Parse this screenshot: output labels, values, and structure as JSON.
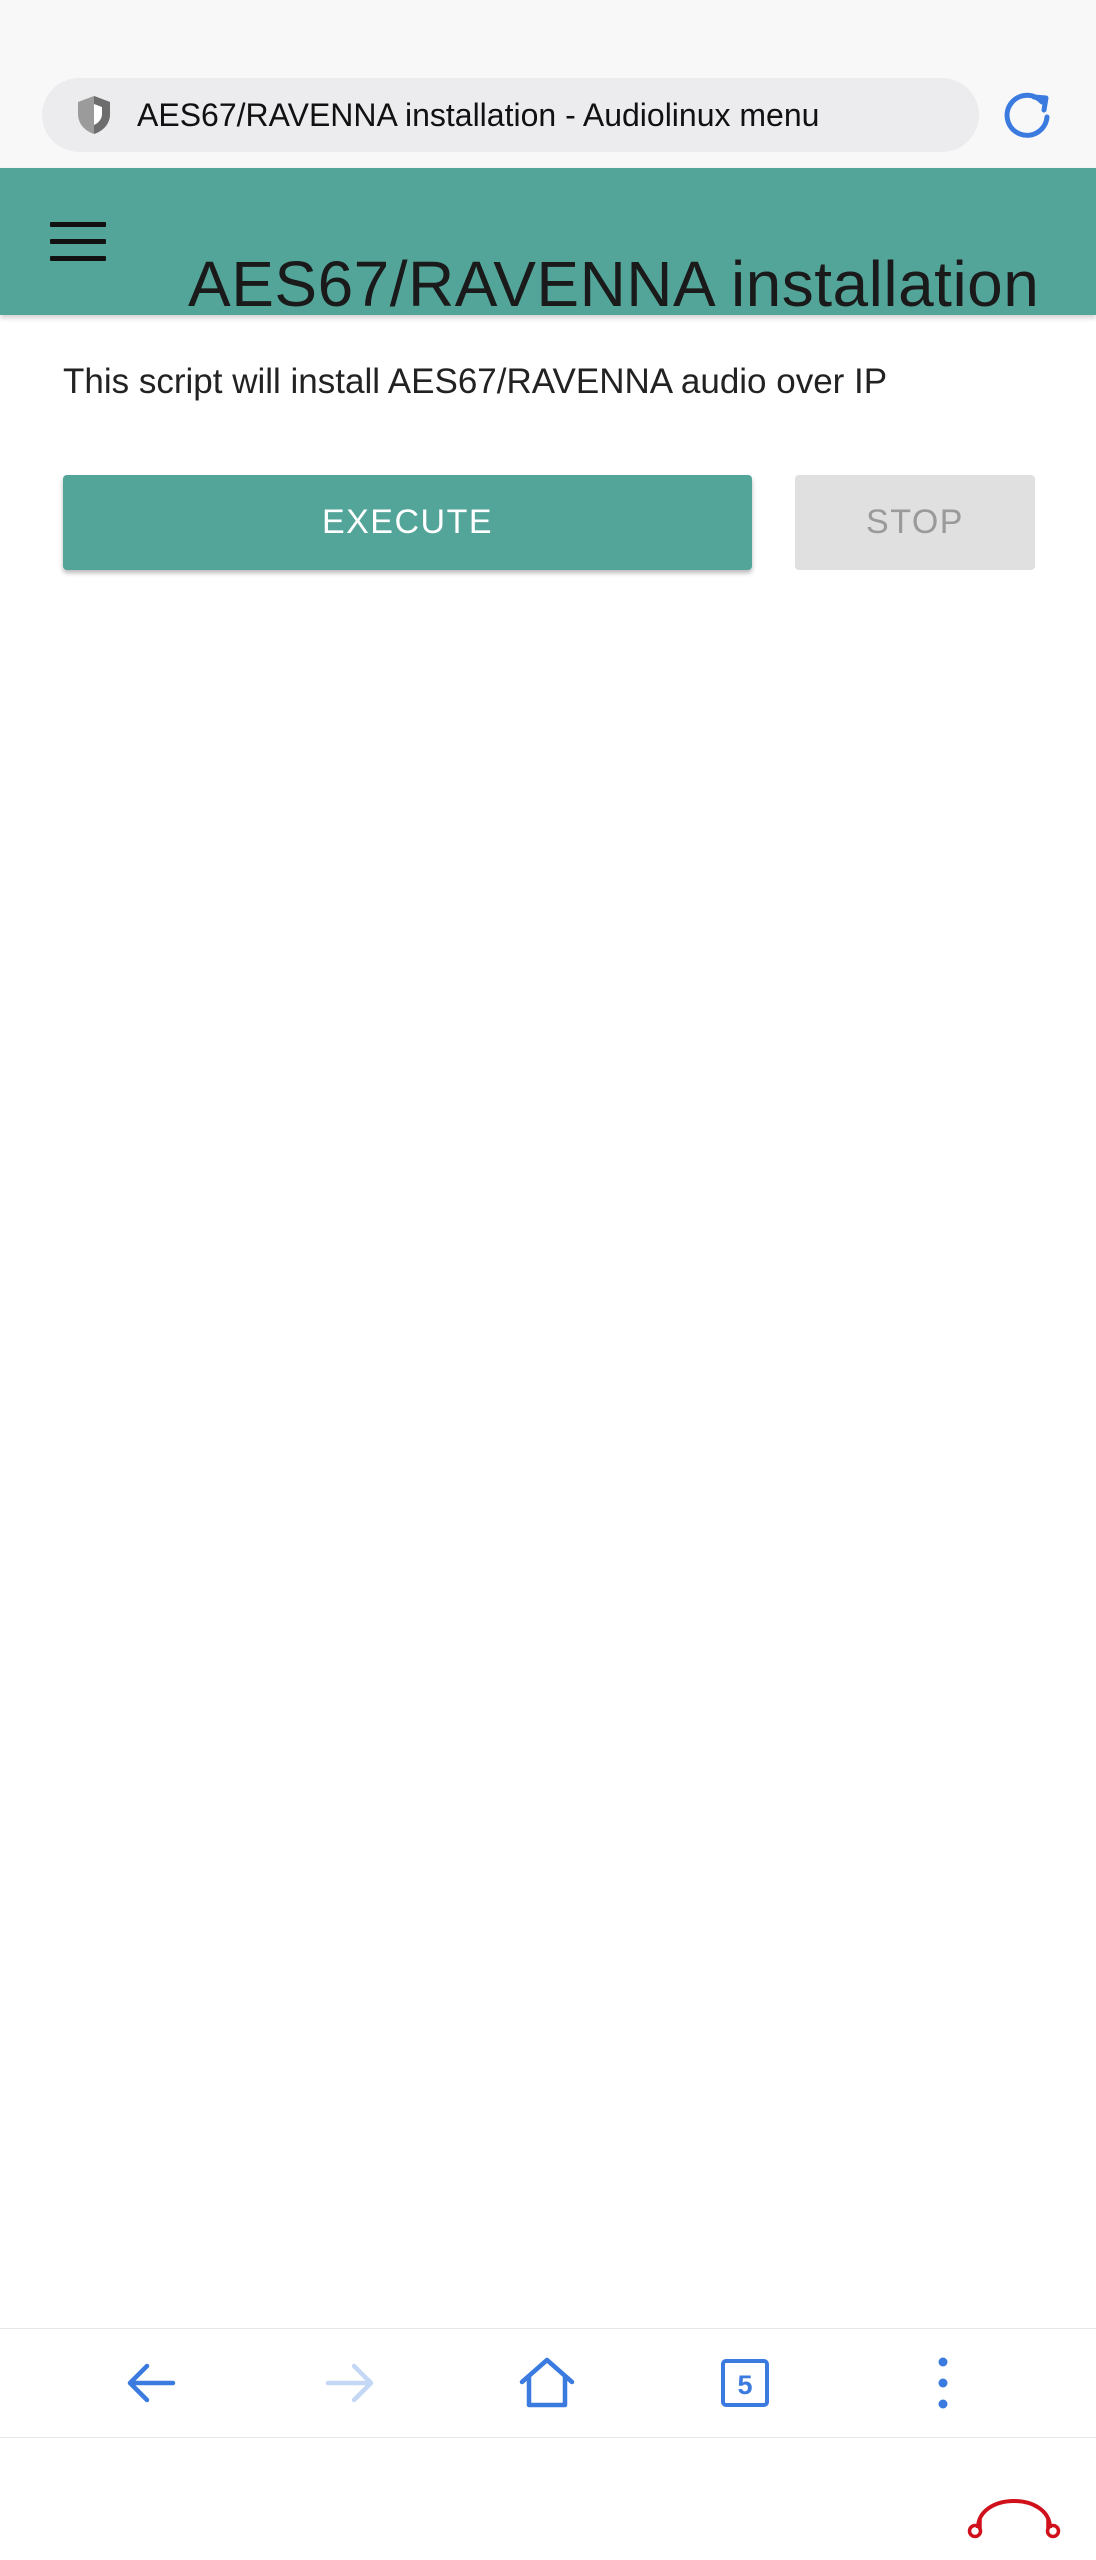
{
  "browser": {
    "url_text": "AES67/RAVENNA installation - Audiolinux menu",
    "tab_count": "5"
  },
  "app_bar": {
    "title": "AES67/RAVENNA installation"
  },
  "content": {
    "description": "This script will install AES67/RAVENNA audio over IP",
    "execute_label": "EXECUTE",
    "stop_label": "STOP"
  },
  "icons": {
    "security": "shield-icon",
    "reload": "reload-icon",
    "menu": "hamburger-menu-icon",
    "back": "arrow-left-icon",
    "forward": "arrow-right-icon",
    "home": "home-icon",
    "tabs": "tabs-icon",
    "more": "more-vertical-icon",
    "logo": "headphones-logo-icon"
  },
  "colors": {
    "accent": "#53a59a",
    "browser_blue": "#3b7be0",
    "browser_blue_disabled": "#c4d8f5",
    "logo_red": "#d0101b"
  }
}
